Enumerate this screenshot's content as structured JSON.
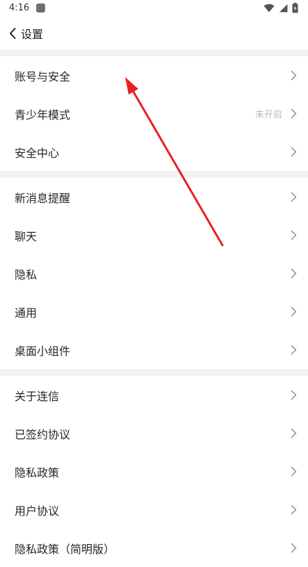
{
  "status_bar": {
    "time": "4:16"
  },
  "header": {
    "back_icon": "chevron-left-icon",
    "title": "设置"
  },
  "sections": [
    {
      "items": [
        {
          "label": "账号与安全",
          "value": ""
        },
        {
          "label": "青少年模式",
          "value": "未开启"
        },
        {
          "label": "安全中心",
          "value": ""
        }
      ]
    },
    {
      "items": [
        {
          "label": "新消息提醒",
          "value": ""
        },
        {
          "label": "聊天",
          "value": ""
        },
        {
          "label": "隐私",
          "value": ""
        },
        {
          "label": "通用",
          "value": ""
        },
        {
          "label": "桌面小组件",
          "value": ""
        }
      ]
    },
    {
      "items": [
        {
          "label": "关于连信",
          "value": ""
        },
        {
          "label": "已签约协议",
          "value": ""
        },
        {
          "label": "隐私政策",
          "value": ""
        },
        {
          "label": "用户协议",
          "value": ""
        },
        {
          "label": "隐私政策（简明版）",
          "value": ""
        }
      ]
    }
  ],
  "colors": {
    "annotation_arrow": "#e8201f",
    "section_gap": "#f2f2f2",
    "secondary_text": "#b8b8b8"
  }
}
